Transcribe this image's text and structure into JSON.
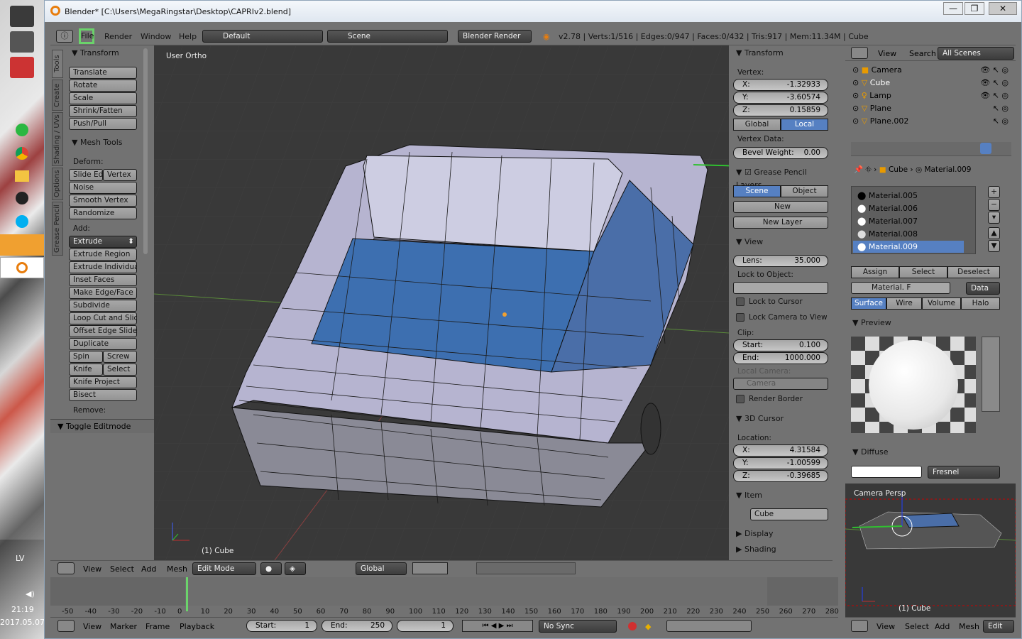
{
  "titlebar": {
    "title": "Blender* [C:\\Users\\MegaRingstar\\Desktop\\CAPRIv2.blend]"
  },
  "taskbar": {
    "lang": "LV",
    "time": "21:19",
    "date": "2017.05.07."
  },
  "info_header": {
    "menu": [
      "File",
      "Render",
      "Window",
      "Help"
    ],
    "layout": "Default",
    "scene": "Scene",
    "engine": "Blender Render",
    "stats": "v2.78 | Verts:1/516 | Edges:0/947 | Faces:0/432 | Tris:917 | Mem:11.34M | Cube"
  },
  "toolshelf": {
    "tabs": [
      "Tools",
      "Create",
      "Shading / UVs",
      "Options",
      "Grease Pencil"
    ],
    "transform_title": "Transform",
    "transform": [
      "Translate",
      "Rotate",
      "Scale",
      "Shrink/Fatten",
      "Push/Pull"
    ],
    "mesh_tools_title": "Mesh Tools",
    "deform_label": "Deform:",
    "slide_edge": "Slide Ed",
    "vertex": "Vertex",
    "noise": "Noise",
    "smooth_vertex": "Smooth Vertex",
    "randomize": "Randomize",
    "add_label": "Add:",
    "extrude": "Extrude",
    "add": [
      "Extrude Region",
      "Extrude Individual",
      "Inset Faces",
      "Make Edge/Face",
      "Subdivide",
      "Loop Cut and Slide",
      "Offset Edge Slide",
      "Duplicate"
    ],
    "spin": "Spin",
    "screw": "Screw",
    "knife": "Knife",
    "select": "Select",
    "knife_project": "Knife Project",
    "bisect": "Bisect",
    "remove_label": "Remove:",
    "toggle_editmode": "Toggle Editmode"
  },
  "viewport": {
    "view_name": "User Ortho",
    "object_label": "(1) Cube"
  },
  "npanel": {
    "transform_title": "Transform",
    "vertex_label": "Vertex:",
    "x_label": "X:",
    "x": "-1.32933",
    "y_label": "Y:",
    "y": "-3.60574",
    "z_label": "Z:",
    "z": "0.15859",
    "global": "Global",
    "local": "Local",
    "vertex_data": "Vertex Data:",
    "bevel_label": "Bevel Weight:",
    "bevel": "0.00",
    "grease_title": "Grease Pencil Layers",
    "scene": "Scene",
    "object": "Object",
    "new": "New",
    "new_layer": "New Layer",
    "view_title": "View",
    "lens_label": "Lens:",
    "lens": "35.000",
    "lock_object": "Lock to Object:",
    "lock_cursor": "Lock to Cursor",
    "lock_camera": "Lock Camera to View",
    "clip": "Clip:",
    "start_label": "Start:",
    "start": "0.100",
    "end_label": "End:",
    "end": "1000.000",
    "local_camera": "Local Camera:",
    "camera": "Camera",
    "render_border": "Render Border",
    "cursor_title": "3D Cursor",
    "location": "Location:",
    "cx": "4.31584",
    "cy": "-1.00599",
    "cz": "-0.39685",
    "item_title": "Item",
    "item_name": "Cube",
    "display_title": "Display",
    "shading_title": "Shading"
  },
  "view3d_header": {
    "menus": [
      "View",
      "Select",
      "Add",
      "Mesh"
    ],
    "mode": "Edit Mode",
    "orientation": "Global"
  },
  "timeline": {
    "ticks": [
      "-50",
      "-40",
      "-30",
      "-20",
      "-10",
      "0",
      "10",
      "20",
      "30",
      "40",
      "50",
      "60",
      "70",
      "80",
      "90",
      "100",
      "110",
      "120",
      "130",
      "140",
      "150",
      "160",
      "170",
      "180",
      "190",
      "200",
      "210",
      "220",
      "230",
      "240",
      "250",
      "260",
      "270",
      "280"
    ],
    "menus": [
      "View",
      "Marker",
      "Frame",
      "Playback"
    ],
    "start_label": "Start:",
    "start": "1",
    "end_label": "End:",
    "end": "250",
    "current": "1",
    "sync": "No Sync"
  },
  "outliner": {
    "menus": [
      "View",
      "Search"
    ],
    "scenes": "All Scenes",
    "items": [
      "Camera",
      "Cube",
      "Lamp",
      "Plane",
      "Plane.002"
    ]
  },
  "properties": {
    "breadcrumb_obj": "Cube",
    "breadcrumb_mat": "Material.009",
    "materials": [
      "Material.005",
      "Material.006",
      "Material.007",
      "Material.008",
      "Material.009"
    ],
    "assign": "Assign",
    "select": "Select",
    "deselect": "Deselect",
    "mat_field": "Material.",
    "mat_f": "F",
    "data": "Data",
    "tabs": [
      "Surface",
      "Wire",
      "Volume",
      "Halo"
    ],
    "preview": "Preview",
    "diffuse": "Diffuse",
    "fresnel": "Fresnel"
  },
  "camera_view": {
    "label": "Camera Persp",
    "object_label": "(1) Cube",
    "menus": [
      "View",
      "Select",
      "Add",
      "Mesh"
    ],
    "edit": "Edit"
  },
  "colors": {
    "accent": "#5680c2",
    "viewport": "#393939",
    "panel": "#727272"
  }
}
